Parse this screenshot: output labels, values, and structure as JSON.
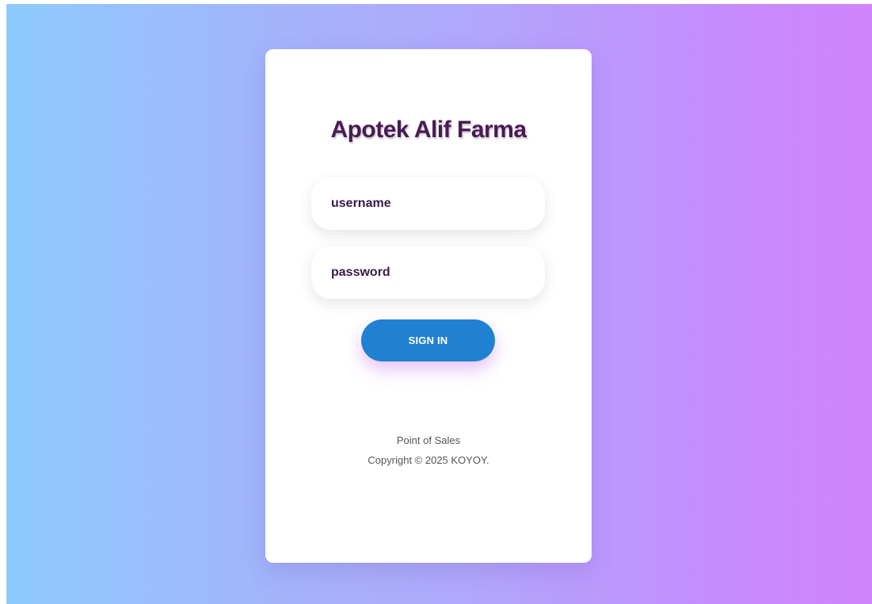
{
  "brand": {
    "title": "Apotek Alif Farma"
  },
  "form": {
    "username": {
      "placeholder": "username",
      "value": ""
    },
    "password": {
      "placeholder": "password",
      "value": ""
    },
    "submit_label": "SIGN IN"
  },
  "footer": {
    "line1": "Point of Sales",
    "line2": "Copyright © 2025 KOYOY."
  },
  "colors": {
    "gradient_start": "#8ecbfc",
    "gradient_end": "#d184fb",
    "title": "#4a1a55",
    "button": "#2081d2"
  }
}
